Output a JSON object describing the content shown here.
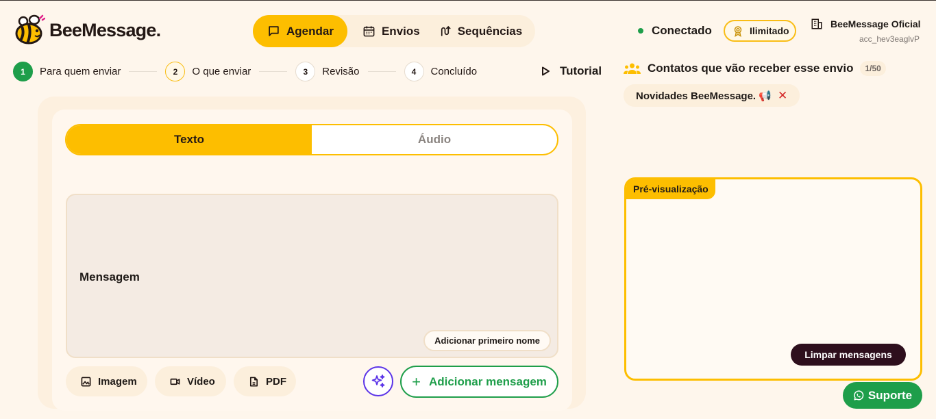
{
  "brand": {
    "name": "BeeMessage."
  },
  "nav": {
    "items": [
      {
        "label": "Agendar",
        "icon": "message-square-icon",
        "active": true
      },
      {
        "label": "Envios",
        "icon": "calendar-icon"
      },
      {
        "label": "Sequências",
        "icon": "route-icon"
      }
    ]
  },
  "connection": {
    "label": "Conectado",
    "color": "#1e9e4a"
  },
  "plan": {
    "label": "Ilimitado"
  },
  "account": {
    "name": "BeeMessage Oficial",
    "id": "acc_hev3eaglvP"
  },
  "stepper": {
    "steps": [
      {
        "num": "1",
        "label": "Para quem enviar",
        "state": "done"
      },
      {
        "num": "2",
        "label": "O que enviar",
        "state": "current"
      },
      {
        "num": "3",
        "label": "Revisão",
        "state": "pending"
      },
      {
        "num": "4",
        "label": "Concluído",
        "state": "pending"
      }
    ],
    "tutorial_label": "Tutorial"
  },
  "composer": {
    "tabs": [
      {
        "label": "Texto",
        "active": true
      },
      {
        "label": "Áudio",
        "active": false
      }
    ],
    "message_label": "Mensagem",
    "first_name_button": "Adicionar primeiro nome",
    "attachments": [
      {
        "label": "Imagem",
        "icon": "image-icon"
      },
      {
        "label": "Vídeo",
        "icon": "video-icon"
      },
      {
        "label": "PDF",
        "icon": "file-icon"
      }
    ],
    "ai_icon": "sparkles-icon",
    "add_message_label": "Adicionar mensagem"
  },
  "contacts": {
    "title": "Contatos que vão receber esse envio",
    "count": "1/50",
    "chips": [
      {
        "label": "Novidades BeeMessage. 📢",
        "remove": "✕"
      }
    ]
  },
  "preview": {
    "tag": "Pré-visualização",
    "clear_label": "Limpar mensagens"
  },
  "support": {
    "label": "Suporte"
  },
  "colors": {
    "accent": "#fdbe00",
    "success": "#1e9e4a",
    "dark": "#2e0f1d",
    "ai": "#5b34e8",
    "danger": "#d42a2a"
  }
}
